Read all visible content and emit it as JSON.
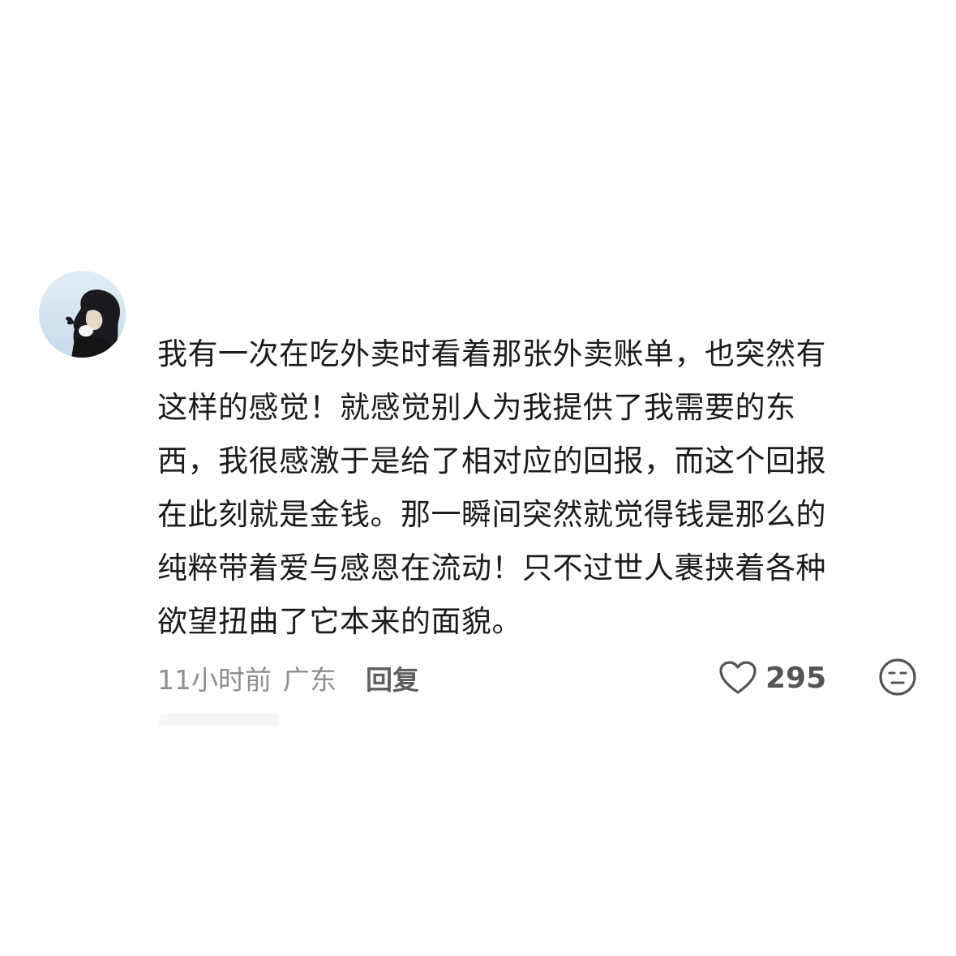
{
  "comment": {
    "text": "我有一次在吃外卖时看着那张外卖账单，也突然有\n这样的感觉！就感觉别人为我提供了我需要的东\n西，我很感激于是给了相对应的回报，而这个回报\n在此刻就是金钱。那一瞬间突然就觉得钱是那么的\n纯粹带着爱与感恩在流动！只不过世人裹挟着各种\n欲望扭曲了它本来的面貌。",
    "time": "11小时前",
    "location": "广东",
    "reply_label": "回复",
    "like_count": "295"
  },
  "icons": {
    "like": "heart-outline-icon",
    "reaction": "neutral-face-emoji-icon"
  },
  "colors": {
    "text": "#1c1c1c",
    "meta": "#8f8f8f",
    "reply": "#5f5f5f",
    "icon": "#555555"
  }
}
